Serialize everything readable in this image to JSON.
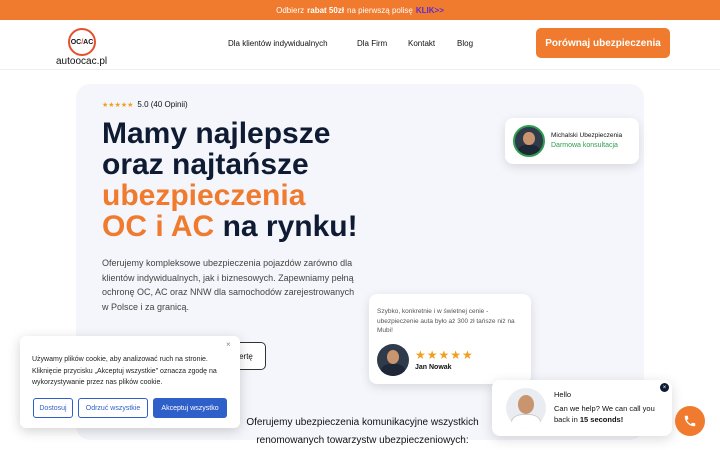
{
  "promo": {
    "prefix": "Odbierz",
    "bold": "rabat 50zł",
    "middle": "na pierwszą polisę",
    "link": "KLIK>>"
  },
  "header": {
    "logo_mark_left": "OC",
    "logo_mark_slash": "/",
    "logo_mark_right": "AC",
    "logo_name": "autoocac.pl",
    "nav": [
      "Dla klientów indywidualnych",
      "Dla Firm",
      "Kontakt",
      "Blog"
    ],
    "cta": "Porównaj ubezpieczenia"
  },
  "hero": {
    "stars": "★★★★★",
    "rating": "5.0 (40 Opinii)",
    "headline": {
      "l1": "Mamy najlepsze",
      "l2": "oraz najtańsze",
      "l3": "ubezpieczenia",
      "l4_orange": "OC i AC",
      "l4_rest": "na rynku!"
    },
    "description": "Oferujemy kompleksowe ubezpieczenia pojazdów zarówno dla klientów indywidualnych, jak i biznesowych. Zapewniamy pełną ochronę OC, AC oraz NNW dla samochodów zarejestrowanych w Polsce i za granicą.",
    "outline_button": "ertę"
  },
  "consult_card": {
    "name": "Michalski Ubezpieczenia",
    "sub": "Darmowa konsultacja"
  },
  "review_card": {
    "text": "Szybko, konkretnie i w świetnej cenie - ubezpieczenie auta było aż 300 zł tańsze niż na Mubi!",
    "stars": "★★★★★",
    "author": "Jan Nowak"
  },
  "cookie": {
    "close": "×",
    "text": "Używamy plików cookie, aby analizować ruch na stronie. Kliknięcie przycisku „Akceptuj wszystkie” oznacza zgodę na wykorzystywanie przez nas plików cookie.",
    "buttons": [
      "Dostosuj",
      "Odrzuć wszystkie",
      "Akceptuj wszystko"
    ]
  },
  "section": {
    "text": "Oferujemy ubezpieczenia komunikacyjne wszystkich renomowanych towarzystw ubezpieczeniowych:"
  },
  "chat": {
    "close": "×",
    "hello": "Hello",
    "msg_start": "Can we help? We can call you back in",
    "msg_bold": "15 seconds!"
  },
  "colors": {
    "accent": "#f07a2d",
    "navy": "#0f1b33",
    "blue": "#2f5fc9",
    "green": "#2e9e4e",
    "star": "#f0a020"
  }
}
